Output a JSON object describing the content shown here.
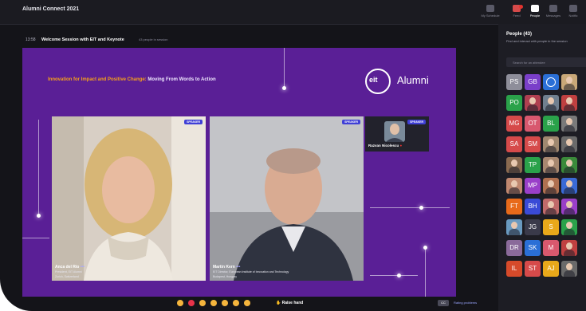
{
  "app": {
    "title": "Alumni Connect 2021"
  },
  "nav": {
    "items": [
      {
        "label": "My Schedule",
        "icon": "calendar-icon",
        "active": false
      },
      {
        "label": "Feed",
        "icon": "feed-icon",
        "active": false
      },
      {
        "label": "People",
        "icon": "people-icon",
        "active": true
      },
      {
        "label": "Messages",
        "icon": "messages-icon",
        "active": false
      },
      {
        "label": "Notific",
        "icon": "bell-icon",
        "active": false
      }
    ]
  },
  "session": {
    "time": "13:58",
    "title": "Welcome Session with EIT and Keynote",
    "people": "43 people in session"
  },
  "stage": {
    "slogan_highlight": "Innovation for Impact and Positive Change:",
    "slogan_rest": " Moving From Words to Action",
    "logo_mark": "eit",
    "logo_word": "Alumni"
  },
  "speakers": [
    {
      "badge": "SPEAKER",
      "name": "Anca del Rio",
      "suffix": "•••",
      "line1": "President, EIT Alumni",
      "line2": "Zurich, Switzerland"
    },
    {
      "badge": "SPEAKER",
      "name": "Martin Kern",
      "suffix": "•••",
      "line1": "EIT Director, European Institute of Innovation and Technology",
      "line2": "Budapest, Hungary"
    },
    {
      "badge": "SPEAKER",
      "name": "Razvan Nicolescu",
      "suffix": ""
    }
  ],
  "controls": {
    "raise_hand": "Raise hand",
    "rate": "Rating problems",
    "reactions": [
      {
        "icon": "clap-icon",
        "color": "#f5b53d"
      },
      {
        "icon": "heart-icon",
        "color": "#e8334a"
      },
      {
        "icon": "thumbs-up-icon",
        "color": "#f5b53d"
      },
      {
        "icon": "laugh-icon",
        "color": "#f5b53d"
      },
      {
        "icon": "wow-icon",
        "color": "#f5b53d"
      },
      {
        "icon": "party-icon",
        "color": "#f5b53d"
      },
      {
        "icon": "thinking-icon",
        "color": "#f5b53d"
      }
    ]
  },
  "people_panel": {
    "title": "People (43)",
    "subtitle": "Find and interact with people in the session",
    "search_placeholder": "Search for an attendee",
    "rows": [
      [
        {
          "t": "PS",
          "c": "#8e8e9a"
        },
        {
          "t": "GB",
          "c": "#7a3fc9"
        },
        {
          "t": "",
          "c": "#2a6fd6",
          "logo": true
        },
        {
          "t": "",
          "c": "#c9a878",
          "photo": true
        }
      ],
      [
        {
          "t": "PO",
          "c": "#2aa24a"
        },
        {
          "t": "",
          "c": "#b04050",
          "photo": true
        },
        {
          "t": "",
          "c": "#708090",
          "photo": true
        },
        {
          "t": "",
          "c": "#c04040",
          "photo": true
        }
      ],
      [
        {
          "t": "MG",
          "c": "#d64a4a"
        },
        {
          "t": "OT",
          "c": "#d8586e"
        },
        {
          "t": "BL",
          "c": "#2aa24a"
        },
        {
          "t": "",
          "c": "#7a7a7a",
          "photo": true
        }
      ],
      [
        {
          "t": "SA",
          "c": "#d64a4a"
        },
        {
          "t": "SM",
          "c": "#d64a4a"
        },
        {
          "t": "",
          "c": "#a08870",
          "photo": true
        },
        {
          "t": "",
          "c": "#6a6a6a",
          "photo": true
        }
      ],
      [
        {
          "t": "",
          "c": "#8a6a50",
          "photo": true
        },
        {
          "t": "TP",
          "c": "#2aa24a"
        },
        {
          "t": "",
          "c": "#a88870",
          "photo": true
        },
        {
          "t": "",
          "c": "#3a8a3a",
          "photo": true
        }
      ],
      [
        {
          "t": "",
          "c": "#c08870",
          "photo": true
        },
        {
          "t": "MP",
          "c": "#9a3fc9"
        },
        {
          "t": "",
          "c": "#b07050",
          "photo": true
        },
        {
          "t": "",
          "c": "#3a6ad6",
          "photo": true
        }
      ],
      [
        {
          "t": "FT",
          "c": "#e86a1a"
        },
        {
          "t": "BH",
          "c": "#3a4ad6"
        },
        {
          "t": "",
          "c": "#c06a6a",
          "photo": true
        },
        {
          "t": "",
          "c": "#9a3fc9",
          "photo": true
        }
      ],
      [
        {
          "t": "",
          "c": "#6a9ac0",
          "photo": true
        },
        {
          "t": "JG",
          "c": "#3a3a4a"
        },
        {
          "t": "S",
          "c": "#e8a81a"
        },
        {
          "t": "",
          "c": "#2aa24a",
          "photo": true
        }
      ],
      [
        {
          "t": "DR",
          "c": "#8a6a9a"
        },
        {
          "t": "SK",
          "c": "#2a6fd6"
        },
        {
          "t": "M",
          "c": "#d8586e"
        },
        {
          "t": "",
          "c": "#c04040",
          "photo": true
        }
      ],
      [
        {
          "t": "IL",
          "c": "#d64a2a"
        },
        {
          "t": "ST",
          "c": "#d64a4a"
        },
        {
          "t": "AJ",
          "c": "#e8a81a"
        },
        {
          "t": "",
          "c": "#6a6a6a",
          "photo": true
        }
      ]
    ]
  },
  "colors": {
    "stage": "#5a1f96",
    "accent_orange": "#f7a11a",
    "speaker_badge": "#3f3fd6"
  }
}
